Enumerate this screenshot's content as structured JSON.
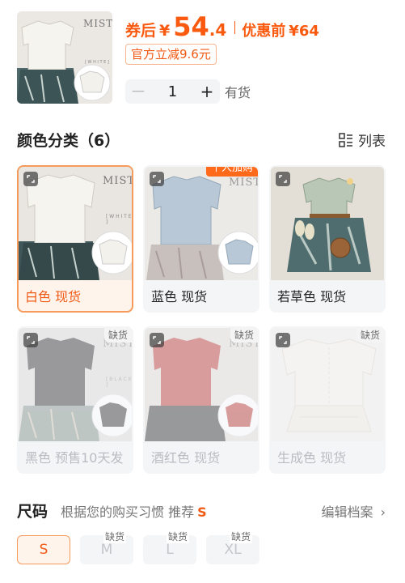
{
  "header": {
    "coupon_label": "券后",
    "currency": "¥",
    "price_int": "54",
    "price_dec": ".4",
    "orig_label": "优惠前",
    "orig_price": "¥64",
    "discount_badge": "官方立减9.6元",
    "quantity": "1",
    "minus": "－",
    "plus": "+",
    "stock_status": "有货"
  },
  "colors_section": {
    "title": "颜色分类（6）",
    "view_toggle": "列表",
    "items": [
      {
        "label": "白色 现货",
        "selected": true
      },
      {
        "label": "蓝色 现货",
        "tag": "千人加购"
      },
      {
        "label": "若草色 现货"
      },
      {
        "label": "黑色 预售10天发",
        "tag": "缺货"
      },
      {
        "label": "酒红色 现货",
        "tag": "缺货"
      },
      {
        "label": "生成色 现货",
        "tag": "缺货"
      }
    ]
  },
  "size_section": {
    "title": "尺码",
    "hint": "根据您的购买习惯 推荐",
    "recommended": "S",
    "archive_link": "编辑档案",
    "sizes": [
      {
        "label": "S",
        "selected": true
      },
      {
        "label": "M",
        "tag": "缺货"
      },
      {
        "label": "L",
        "tag": "缺货"
      },
      {
        "label": "XL",
        "tag": "缺货"
      }
    ]
  },
  "image_text": {
    "brand": "MIST",
    "color_white": "[ W H I T E ]",
    "color_black": "[ B L A C K ]"
  },
  "colors": {
    "accent": "#fa5a0f",
    "selected_border": "#f69b5b"
  }
}
